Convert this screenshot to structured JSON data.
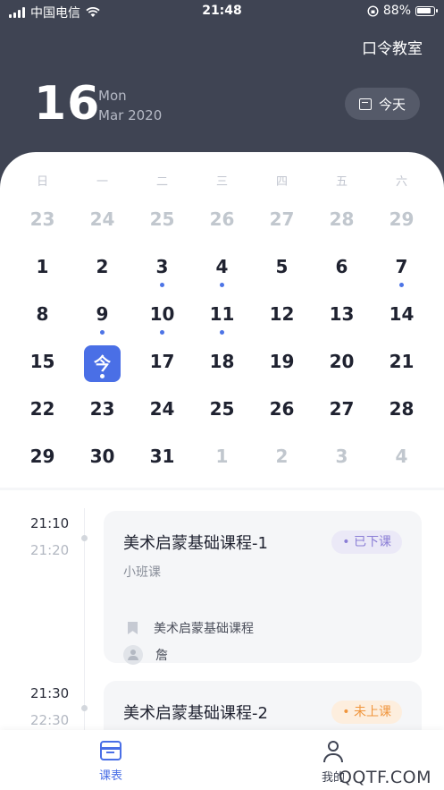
{
  "status_bar": {
    "carrier": "中国电信",
    "time": "21:48",
    "battery": "88%"
  },
  "header": {
    "org_name": "口令教室",
    "big_day": "16",
    "weekday": "Mon",
    "month_year": "Mar 2020",
    "today_label": "今天"
  },
  "calendar": {
    "weekdays": [
      "日",
      "一",
      "二",
      "三",
      "四",
      "五",
      "六"
    ],
    "days": [
      {
        "label": "23",
        "muted": true,
        "dot": false
      },
      {
        "label": "24",
        "muted": true,
        "dot": false
      },
      {
        "label": "25",
        "muted": true,
        "dot": false
      },
      {
        "label": "26",
        "muted": true,
        "dot": false
      },
      {
        "label": "27",
        "muted": true,
        "dot": false
      },
      {
        "label": "28",
        "muted": true,
        "dot": false
      },
      {
        "label": "29",
        "muted": true,
        "dot": false
      },
      {
        "label": "1",
        "muted": false,
        "dot": false
      },
      {
        "label": "2",
        "muted": false,
        "dot": false
      },
      {
        "label": "3",
        "muted": false,
        "dot": true
      },
      {
        "label": "4",
        "muted": false,
        "dot": true
      },
      {
        "label": "5",
        "muted": false,
        "dot": false
      },
      {
        "label": "6",
        "muted": false,
        "dot": false
      },
      {
        "label": "7",
        "muted": false,
        "dot": true
      },
      {
        "label": "8",
        "muted": false,
        "dot": false
      },
      {
        "label": "9",
        "muted": false,
        "dot": true
      },
      {
        "label": "10",
        "muted": false,
        "dot": true
      },
      {
        "label": "11",
        "muted": false,
        "dot": true
      },
      {
        "label": "12",
        "muted": false,
        "dot": false
      },
      {
        "label": "13",
        "muted": false,
        "dot": false
      },
      {
        "label": "14",
        "muted": false,
        "dot": false
      },
      {
        "label": "15",
        "muted": false,
        "dot": false
      },
      {
        "label": "今",
        "muted": false,
        "dot": true,
        "selected": true
      },
      {
        "label": "17",
        "muted": false,
        "dot": false
      },
      {
        "label": "18",
        "muted": false,
        "dot": false
      },
      {
        "label": "19",
        "muted": false,
        "dot": false
      },
      {
        "label": "20",
        "muted": false,
        "dot": false
      },
      {
        "label": "21",
        "muted": false,
        "dot": false
      },
      {
        "label": "22",
        "muted": false,
        "dot": false
      },
      {
        "label": "23",
        "muted": false,
        "dot": false
      },
      {
        "label": "24",
        "muted": false,
        "dot": false
      },
      {
        "label": "25",
        "muted": false,
        "dot": false
      },
      {
        "label": "26",
        "muted": false,
        "dot": false
      },
      {
        "label": "27",
        "muted": false,
        "dot": false
      },
      {
        "label": "28",
        "muted": false,
        "dot": false
      },
      {
        "label": "29",
        "muted": false,
        "dot": false
      },
      {
        "label": "30",
        "muted": false,
        "dot": false
      },
      {
        "label": "31",
        "muted": false,
        "dot": false
      },
      {
        "label": "1",
        "muted": true,
        "dot": false
      },
      {
        "label": "2",
        "muted": true,
        "dot": false
      },
      {
        "label": "3",
        "muted": true,
        "dot": false
      },
      {
        "label": "4",
        "muted": true,
        "dot": false
      }
    ]
  },
  "schedule": [
    {
      "start": "21:10",
      "end": "21:20",
      "title": "美术启蒙基础课程-1",
      "status": "已下课",
      "status_type": "done",
      "class_type": "小班课",
      "course": "美术启蒙基础课程",
      "teacher": "詹"
    },
    {
      "start": "21:30",
      "end": "22:30",
      "title": "美术启蒙基础课程-2",
      "status": "未上课",
      "status_type": "pending"
    }
  ],
  "tabbar": {
    "schedule_label": "课表",
    "mine_label": "我的"
  },
  "watermark": "QQTF.COM",
  "colors": {
    "header_bg": "#3f4453",
    "accent": "#4a6fe6",
    "done": "#8b7ed6",
    "pending": "#f0953d"
  }
}
